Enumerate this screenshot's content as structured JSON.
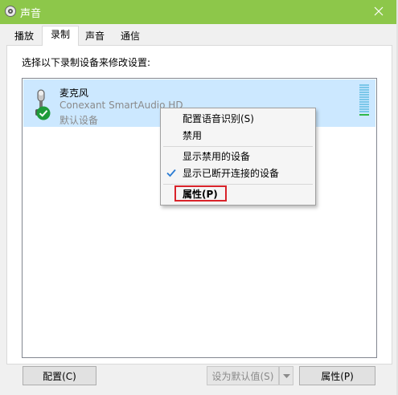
{
  "window": {
    "title": "声音",
    "title_bar_color": "#8dc74a",
    "icon": "speaker-icon",
    "close_icon": "close-icon"
  },
  "tabs": [
    {
      "label": "播放",
      "active": false
    },
    {
      "label": "录制",
      "active": true
    },
    {
      "label": "声音",
      "active": false
    },
    {
      "label": "通信",
      "active": false
    }
  ],
  "panel": {
    "instruction": "选择以下录制设备来修改设置:"
  },
  "device": {
    "name": "麦克风",
    "driver": "Conexant SmartAudio HD",
    "status": "默认设备",
    "icon": "microphone-icon",
    "badge_icon": "default-check-icon",
    "selected_bg": "#cce8ff"
  },
  "context_menu": {
    "items": [
      {
        "label": "配置语音识别(S)"
      },
      {
        "label": "禁用"
      },
      {
        "label": "显示禁用的设备"
      },
      {
        "label": "显示已断开连接的设备",
        "checked": true
      },
      {
        "label": "属性(P)",
        "bold": true,
        "highlighted": true
      }
    ],
    "highlight_color": "#d9232a"
  },
  "buttons": {
    "configure": "配置(C)",
    "set_default": "设为默认值(S)",
    "properties": "属性(P)"
  }
}
